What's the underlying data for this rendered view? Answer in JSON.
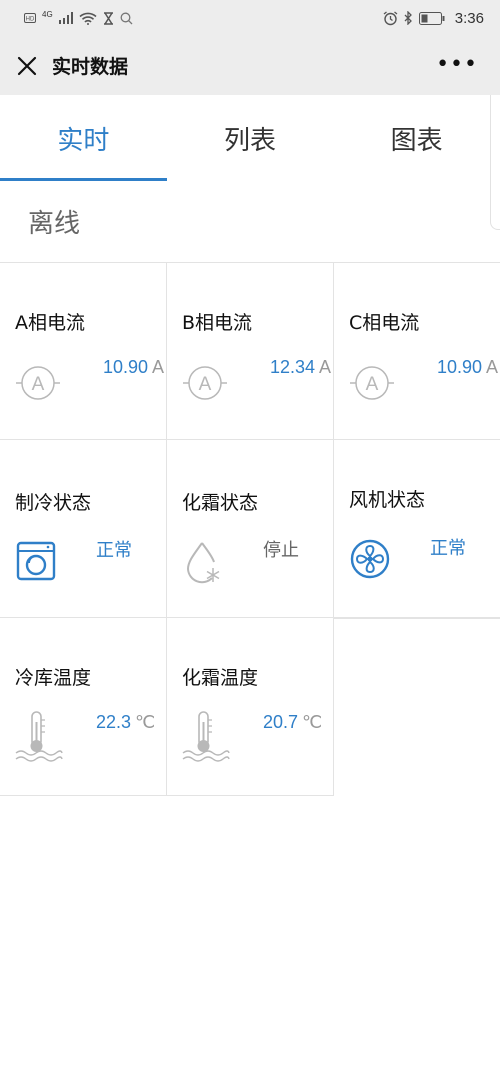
{
  "status_bar": {
    "network": "4G",
    "time": "3:36"
  },
  "nav": {
    "title": "实时数据",
    "more": "•••"
  },
  "tabs": [
    {
      "label": "实时",
      "active": true
    },
    {
      "label": "列表",
      "active": false
    },
    {
      "label": "图表",
      "active": false
    }
  ],
  "connection_status": "离线",
  "accent_color": "#2f7fc8",
  "cards": [
    {
      "label": "A相电流",
      "value": "10.90",
      "unit": "A",
      "icon": "ammeter-icon"
    },
    {
      "label": "B相电流",
      "value": "12.34",
      "unit": "A",
      "icon": "ammeter-icon"
    },
    {
      "label": "C相电流",
      "value": "10.90",
      "unit": "A",
      "icon": "ammeter-icon"
    },
    {
      "label": "制冷状态",
      "value": "正常",
      "icon": "compressor-icon"
    },
    {
      "label": "化霜状态",
      "value": "停止",
      "icon": "defrost-drop-icon"
    },
    {
      "label": "风机状态",
      "value": "正常",
      "icon": "fan-icon"
    },
    {
      "label": "冷库温度",
      "value": "22.3",
      "unit": "℃",
      "icon": "thermometer-icon"
    },
    {
      "label": "化霜温度",
      "value": "20.7",
      "unit": "℃",
      "icon": "thermometer-icon"
    }
  ]
}
